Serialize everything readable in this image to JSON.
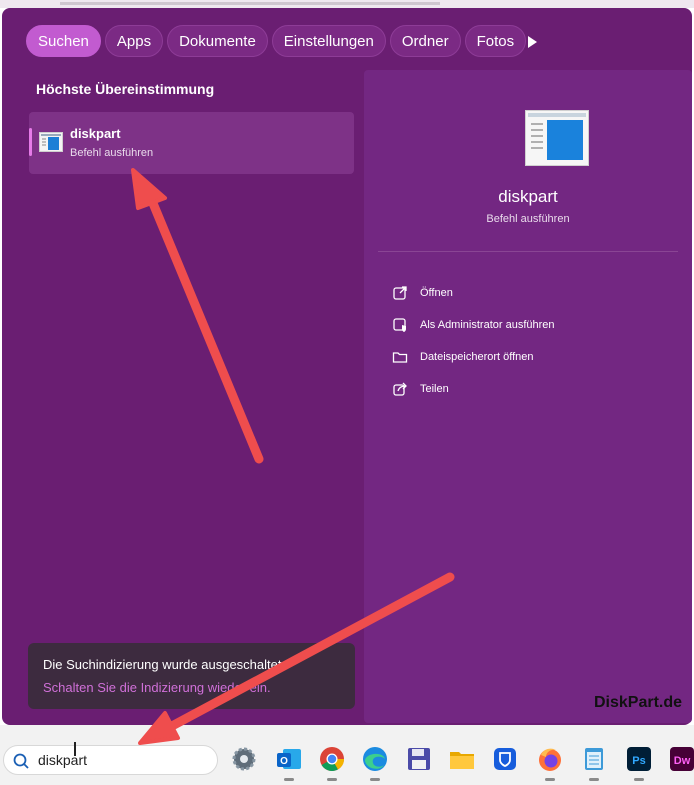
{
  "tabs": {
    "items": [
      "Suchen",
      "Apps",
      "Dokumente",
      "Einstellungen",
      "Ordner",
      "Fotos"
    ],
    "active": "Suchen"
  },
  "best_match": {
    "heading": "Höchste Übereinstimmung",
    "name": "diskpart",
    "subtitle": "Befehl ausführen"
  },
  "detail": {
    "title": "diskpart",
    "subtitle": "Befehl ausführen",
    "actions": [
      "Öffnen",
      "Als Administrator ausführen",
      "Dateispeicherort öffnen",
      "Teilen"
    ]
  },
  "notice": {
    "line1": "Die Suchindizierung wurde ausgeschaltet.",
    "line2": "Schalten Sie die Indizierung wieder ein."
  },
  "watermark": "DiskPart.de",
  "taskbar": {
    "search_value": "diskpart",
    "apps": [
      "settings-icon",
      "outlook-icon",
      "chrome-icon",
      "edge-icon",
      "save-disk-icon",
      "file-explorer-icon",
      "bitwarden-icon",
      "firefox-icon",
      "notepad-icon",
      "photoshop-icon",
      "dreamweaver-icon"
    ],
    "photoshop_label": "Ps",
    "dreamweaver_label": "Dw"
  },
  "colors": {
    "panel_bg": "#6a1e72",
    "accent": "#c25bd0",
    "arrow": "#ef4d4d"
  }
}
